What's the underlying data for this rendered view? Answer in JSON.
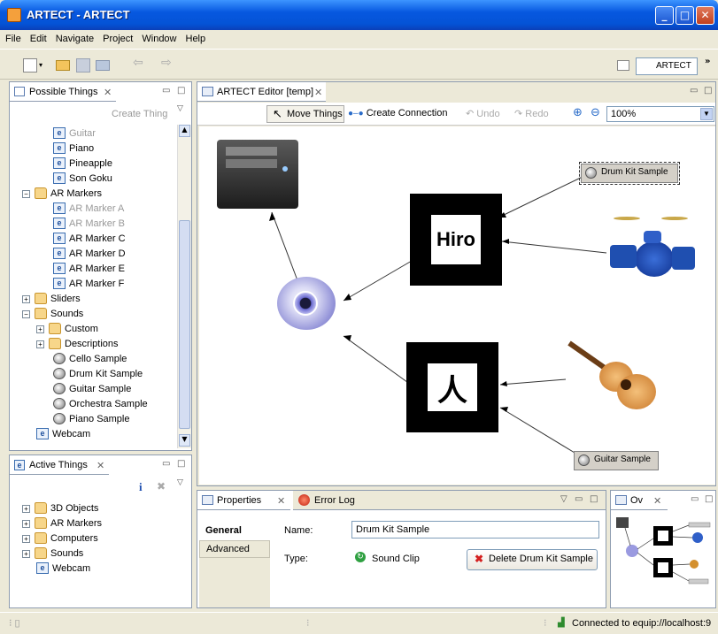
{
  "window": {
    "title": "ARTECT - ARTECT"
  },
  "menu": [
    "File",
    "Edit",
    "Navigate",
    "Project",
    "Window",
    "Help"
  ],
  "perspective": {
    "label": "ARTECT"
  },
  "possible_things": {
    "tab": "Possible Things",
    "create": "Create Thing",
    "items": {
      "guitar": "Guitar",
      "piano": "Piano",
      "pineapple": "Pineapple",
      "songoku": "Son Goku",
      "armarkers": "AR Markers",
      "marker_a": "AR Marker A",
      "marker_b": "AR Marker B",
      "marker_c": "AR Marker C",
      "marker_d": "AR Marker D",
      "marker_e": "AR Marker E",
      "marker_f": "AR Marker F",
      "sliders": "Sliders",
      "sounds": "Sounds",
      "custom": "Custom",
      "descriptions": "Descriptions",
      "cello": "Cello Sample",
      "drumkit": "Drum Kit Sample",
      "guitarsample": "Guitar Sample",
      "orchestra": "Orchestra Sample",
      "pianosample": "Piano Sample",
      "webcam": "Webcam"
    }
  },
  "active_things": {
    "tab": "Active Things",
    "items": {
      "objects3d": "3D Objects",
      "armarkers": "AR Markers",
      "computers": "Computers",
      "sounds": "Sounds",
      "webcam": "Webcam"
    }
  },
  "editor": {
    "tab": "ARTECT Editor [temp]",
    "move": "Move Things",
    "connect": "Create Connection",
    "undo": "Undo",
    "redo": "Redo",
    "zoom": "100%",
    "markers": {
      "hiro": "Hiro",
      "kanji": "人"
    },
    "labels": {
      "drumkit": "Drum Kit Sample",
      "guitar": "Guitar Sample"
    }
  },
  "properties": {
    "tab": "Properties",
    "errorlog": "Error Log",
    "general": "General",
    "advanced": "Advanced",
    "name_label": "Name:",
    "name_value": "Drum Kit Sample",
    "type_label": "Type:",
    "type_value": "Sound Clip",
    "delete": "Delete Drum Kit Sample"
  },
  "outline": {
    "tab": "Ov"
  },
  "status": {
    "connection": "Connected to equip://localhost:9"
  }
}
